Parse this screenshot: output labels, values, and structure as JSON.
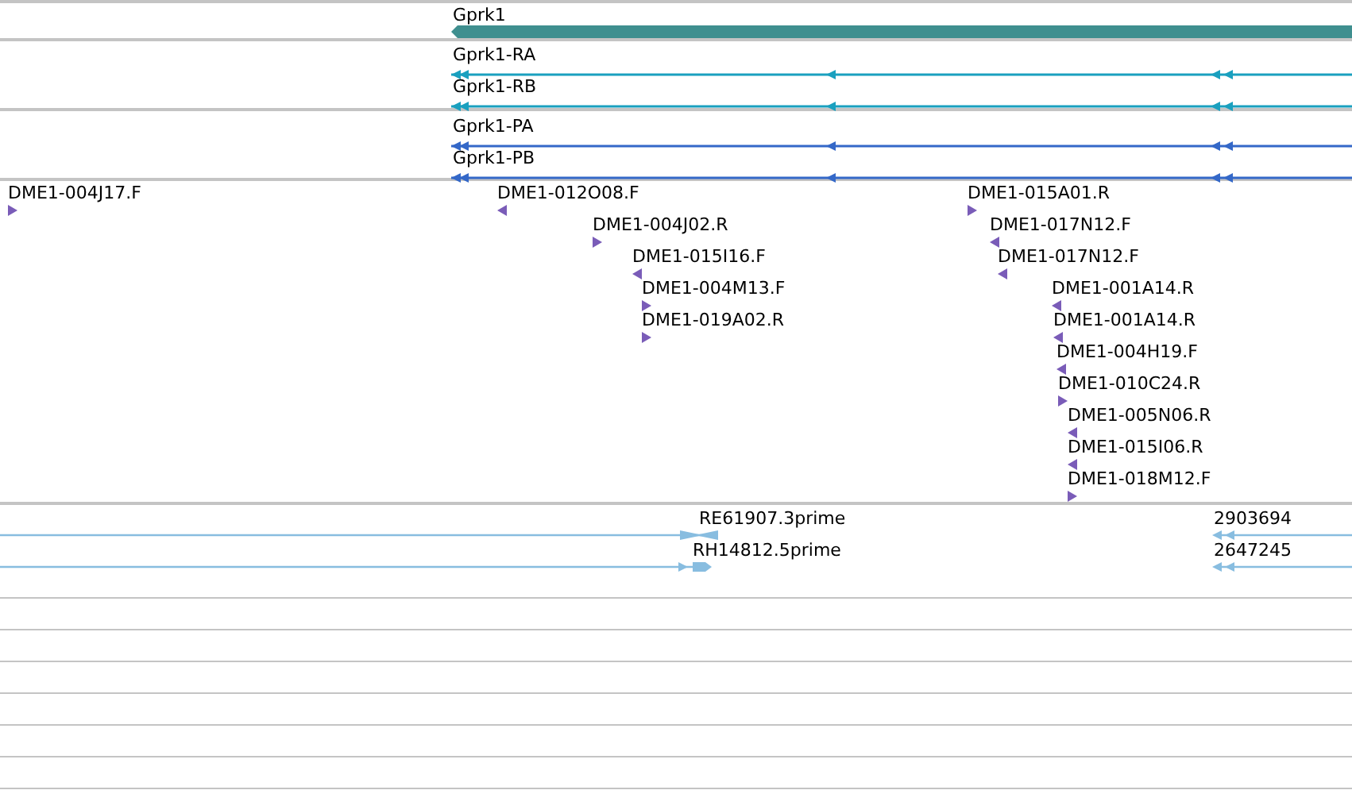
{
  "gene_track": {
    "features": [
      {
        "label": "Gprk1",
        "reverse": true
      }
    ]
  },
  "transcript_track": {
    "features": [
      {
        "label": "Gprk1-RA",
        "reverse": true
      },
      {
        "label": "Gprk1-RB",
        "reverse": true
      }
    ]
  },
  "protein_track": {
    "features": [
      {
        "label": "Gprk1-PA",
        "reverse": true
      },
      {
        "label": "Gprk1-PB",
        "reverse": true
      }
    ]
  },
  "read_track": {
    "features": [
      {
        "label": "DME1-004J17.F",
        "reverse": false
      },
      {
        "label": "DME1-012O08.F",
        "reverse": true
      },
      {
        "label": "DME1-004J02.R",
        "reverse": false
      },
      {
        "label": "DME1-015I16.F",
        "reverse": true
      },
      {
        "label": "DME1-004M13.F",
        "reverse": false
      },
      {
        "label": "DME1-019A02.R",
        "reverse": false
      },
      {
        "label": "DME1-015A01.R",
        "reverse": false
      },
      {
        "label": "DME1-017N12.F",
        "reverse": true
      },
      {
        "label": "DME1-017N12.F",
        "reverse": true
      },
      {
        "label": "DME1-001A14.R",
        "reverse": true
      },
      {
        "label": "DME1-001A14.R",
        "reverse": true
      },
      {
        "label": "DME1-004H19.F",
        "reverse": true
      },
      {
        "label": "DME1-010C24.R",
        "reverse": false
      },
      {
        "label": "DME1-005N06.R",
        "reverse": true
      },
      {
        "label": "DME1-015I06.R",
        "reverse": true
      },
      {
        "label": "DME1-018M12.F",
        "reverse": false
      }
    ]
  },
  "est_track": {
    "features": [
      {
        "label": "RE61907.3prime",
        "kind": "both"
      },
      {
        "label": "2903694",
        "kind": "reverse"
      },
      {
        "label": "RH14812.5prime",
        "kind": "forward"
      },
      {
        "label": "2647245",
        "kind": "reverse"
      }
    ]
  }
}
